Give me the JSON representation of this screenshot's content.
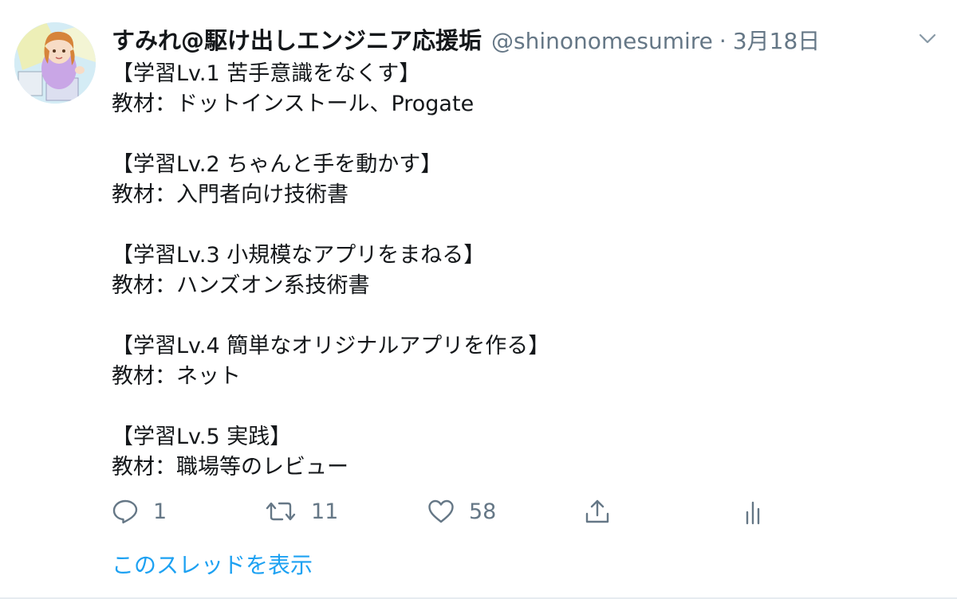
{
  "tweet": {
    "display_name": "すみれ@駆け出しエンジニア応援垢",
    "handle": "@shinonomesumire",
    "separator": "·",
    "date": "3月18日",
    "lines": [
      "【学習Lv.1 苦手意識をなくす】",
      "教材：ドットインストール、Progate",
      "",
      "【学習Lv.2 ちゃんと手を動かす】",
      "教材：入門者向け技術書",
      "",
      "【学習Lv.3 小規模なアプリをまねる】",
      "教材：ハンズオン系技術書",
      "",
      "【学習Lv.4 簡単なオリジナルアプリを作る】",
      "教材：ネット",
      "",
      "【学習Lv.5 実践】",
      "教材：職場等のレビュー"
    ],
    "actions": {
      "reply_count": "1",
      "retweet_count": "11",
      "like_count": "58"
    },
    "thread_link": "このスレッドを表示"
  },
  "icons": {
    "caret": "chevron-down-icon",
    "reply": "reply-icon",
    "retweet": "retweet-icon",
    "like": "heart-icon",
    "share": "share-icon",
    "analytics": "analytics-icon"
  },
  "colors": {
    "text": "#14171a",
    "secondary": "#657786",
    "link": "#1da1f2"
  }
}
